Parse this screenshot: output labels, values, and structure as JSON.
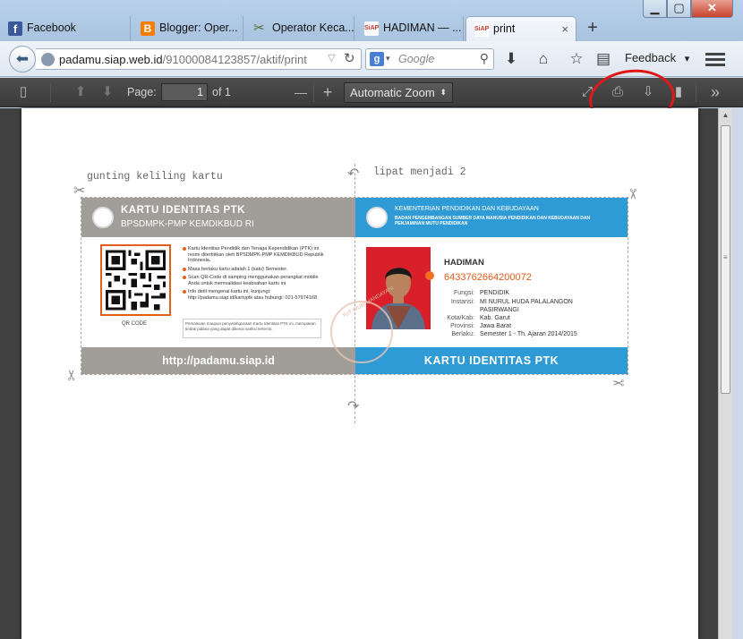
{
  "tabs": [
    {
      "label": "Facebook",
      "icon": "facebook-icon",
      "color": "#3b5998"
    },
    {
      "label": "Blogger: Oper...",
      "icon": "blogger-icon",
      "color": "#f57d00"
    },
    {
      "label": "Operator Keca...",
      "icon": "tools-icon",
      "color": "#556b2f"
    },
    {
      "label": "HADIMAN — ...",
      "icon": "siap-icon",
      "color": "#e8f0ff"
    },
    {
      "label": "print",
      "icon": "siap-icon",
      "color": "#e8f0ff",
      "active": true
    }
  ],
  "tab_close": "×",
  "new_tab": "+",
  "window": {
    "minimize": "▁",
    "maximize": "▢",
    "close": "✕"
  },
  "nav": {
    "url_host": "padamu.siap.web.id",
    "url_path": "/91000084123857/aktif/print",
    "search_placeholder": "Google",
    "search_engine_letter": "g",
    "feedback_label": "Feedback",
    "feedback_arrow": "▾"
  },
  "pdf_toolbar": {
    "page_label": "Page:",
    "page_value": "1",
    "page_count": "of 1",
    "zoom_label": "Automatic Zoom",
    "zoom_minus": "—",
    "zoom_plus": "+"
  },
  "pdf": {
    "cut_instruction": "gunting keliling kartu",
    "fold_instruction": "lipat menjadi 2",
    "left_card": {
      "title": "KARTU IDENTITAS PTK",
      "subtitle": "BPSDMPK-PMP KEMDIKBUD RI",
      "qr_label": "QR CODE",
      "info": [
        "Kartu Identitas Pendidik dan Tenaga Kependidikan (PTK) ini resmi diterbitkan oleh BPSDMPK-PMP KEMDIKBUD Republik Indonesia.",
        "Masa berlaku kartu adalah 1 (satu) Semester.",
        "Scan QR-Code di samping menggunakan perangkat mobile Anda untuk memvalidasi keabsahan kartu ini.",
        "Info detil mengenai kartu ini, kunjungi: http://padamu.siap.id/kartuptk atau hubungi: 021-57974168"
      ],
      "note": "Pemalsuan maupun penyalahgunaan Kartu Identitas PTK ini, merupakan tindak pidana yang dapat dikenai sanksi tertentu.",
      "footer": "http://padamu.siap.id"
    },
    "right_card": {
      "ministry": "KEMENTERIAN PENDIDIKAN DAN KEBUDAYAAN",
      "agency": "BADAN PENGEMBANGAN SUMBER DAYA MANUSIA PENDIDIKAN DAN KEBUDAYAAN DAN PENJAMINAN MUTU PENDIDIKAN",
      "name": "HADIMAN",
      "nuptk": "6433762664200072",
      "fields": [
        {
          "label": "Fungsi:",
          "value": "PENDIDIK"
        },
        {
          "label": "Instansi:",
          "value": "MI NURUL HUDA PALALANGON PASIRWANGI"
        },
        {
          "label": "Kota/Kab:",
          "value": "Kab. Garut"
        },
        {
          "label": "Provinsi:",
          "value": "Jawa Barat"
        },
        {
          "label": "Berlaku:",
          "value": "Semester 1 - Th. Ajaran 2014/2015"
        }
      ],
      "footer": "KARTU IDENTITAS PTK",
      "seal_text": "TUT WURI HANDAYANI"
    }
  },
  "colors": {
    "card_gray": "#a19d98",
    "card_blue": "#2e9bd6",
    "accent_orange": "#e05a1a",
    "highlight_circle": "#e01818"
  }
}
